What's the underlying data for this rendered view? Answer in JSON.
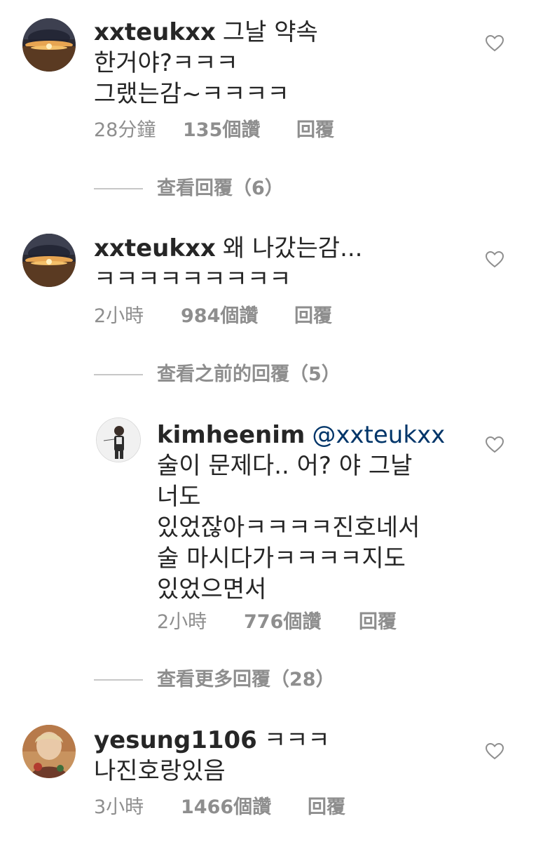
{
  "comments": [
    {
      "username": "xxteukxx",
      "text_lines": [
        "그날 약속",
        "한거야?ㅋㅋㅋ",
        "그랬는감~ㅋㅋㅋㅋ"
      ],
      "time": "28分鐘",
      "likes": "135個讚",
      "reply": "回覆",
      "avatar_icon": "sunset-avatar"
    },
    {
      "username": "xxteukxx",
      "text_lines": [
        "왜 나갔는감...",
        "ㅋㅋㅋㅋㅋㅋㅋㅋㅋ"
      ],
      "time": "2小時",
      "likes": "984個讚",
      "reply": "回覆",
      "avatar_icon": "sunset-avatar"
    },
    {
      "username": "kimheenim",
      "mention": "@xxteukxx",
      "text_lines": [
        "술이 문제다.. 어? 야 그날",
        "너도",
        "있었잖아ㅋㅋㅋㅋ진호네서",
        "술 마시다가ㅋㅋㅋㅋ지도",
        "있었으면서"
      ],
      "time": "2小時",
      "likes": "776個讚",
      "reply": "回覆",
      "avatar_icon": "person-avatar"
    },
    {
      "username": "yesung1106",
      "text_lines": [
        "ㅋㅋㅋ",
        "나진호랑있음"
      ],
      "time": "3小時",
      "likes": "1466個讚",
      "reply": "回覆",
      "avatar_icon": "portrait-avatar"
    }
  ],
  "view_replies": [
    {
      "label": "查看回覆（6）"
    },
    {
      "label": "查看之前的回覆（5）"
    },
    {
      "label": "查看更多回覆（28）"
    }
  ],
  "colors": {
    "text": "#262626",
    "muted": "#8e8e8e",
    "mention": "#003569",
    "divider": "#c7c7c7"
  }
}
